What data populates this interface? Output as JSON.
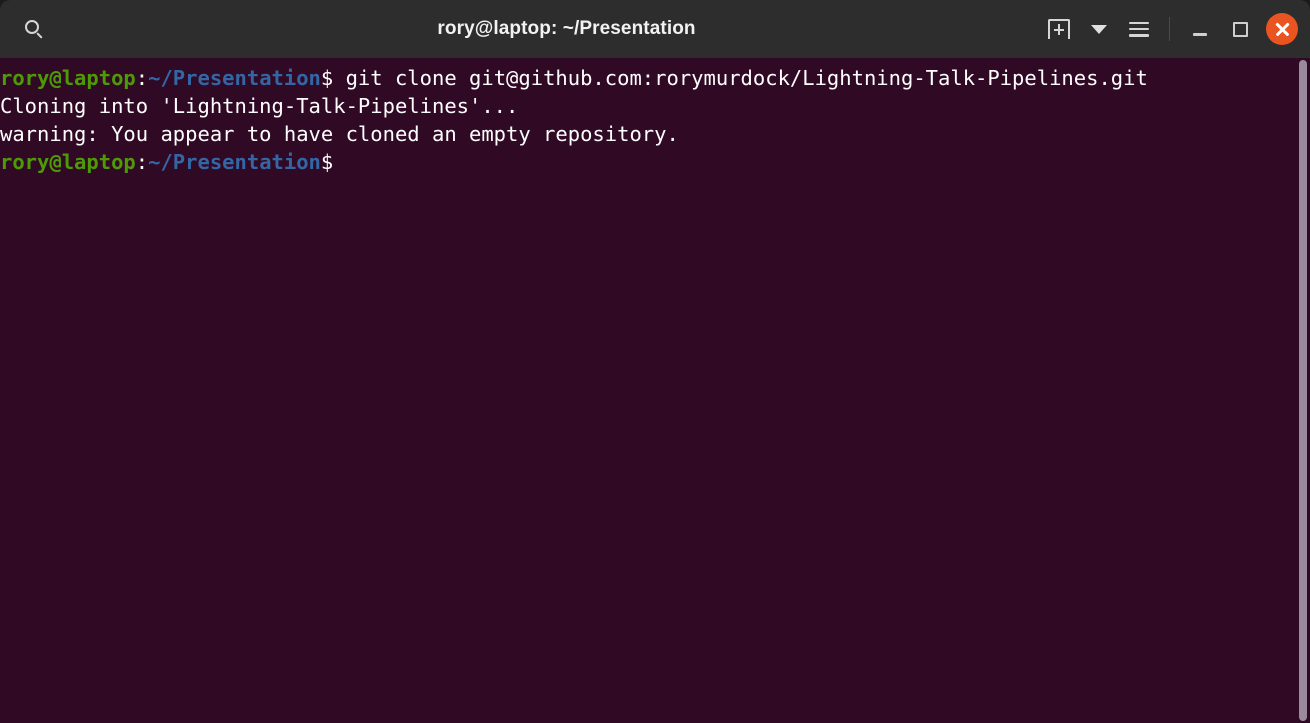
{
  "window": {
    "title": "rory@laptop: ~/Presentation",
    "background_color": "#300a24",
    "titlebar_color": "#2d2d2d"
  },
  "titlebar": {
    "search_icon": "search-icon",
    "new_tab_icon": "new-tab-icon",
    "tab_dropdown_icon": "chevron-down-icon",
    "menu_icon": "hamburger-menu-icon",
    "minimize_icon": "minimize-icon",
    "maximize_icon": "maximize-icon",
    "close_icon": "close-icon",
    "close_color": "#e95420"
  },
  "terminal": {
    "prompt": {
      "user_host": "rory@laptop",
      "colon": ":",
      "path": "~/Presentation",
      "sigil": "$",
      "user_host_color": "#4e9a06",
      "path_color": "#3465a4"
    },
    "lines": [
      {
        "type": "prompt",
        "command": " git clone git@github.com:rorymurdock/Lightning-Talk-Pipelines.git"
      },
      {
        "type": "output",
        "text": "Cloning into 'Lightning-Talk-Pipelines'..."
      },
      {
        "type": "output",
        "text": "warning: You appear to have cloned an empty repository."
      },
      {
        "type": "prompt",
        "command": ""
      }
    ]
  },
  "scrollbar": {
    "thumb_color": "#9b8a9b",
    "position": "full"
  }
}
